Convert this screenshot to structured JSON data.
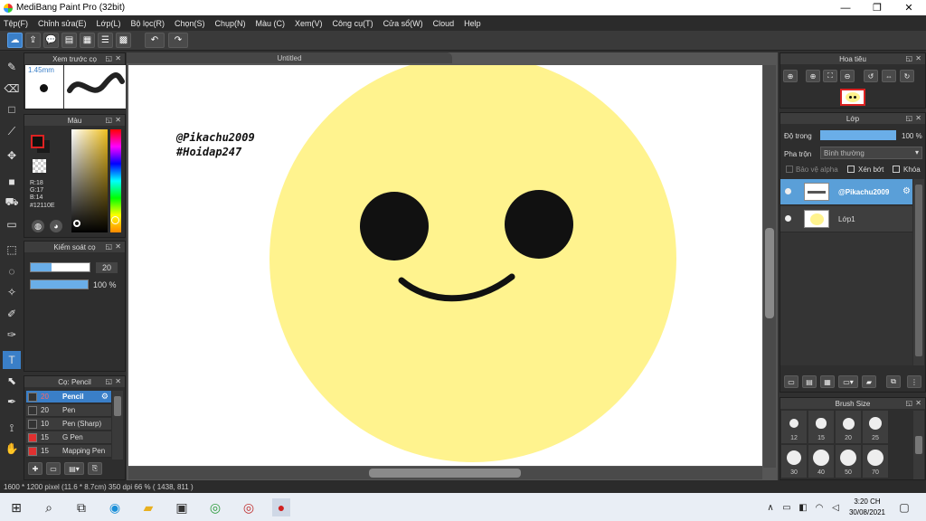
{
  "app": {
    "title": "MediBang Paint Pro (32bit)"
  },
  "window_controls": {
    "minimize": "—",
    "maximize": "❐",
    "close": "✕"
  },
  "menu": [
    "Tệp(F)",
    "Chỉnh sửa(E)",
    "Lớp(L)",
    "Bộ lọc(R)",
    "Chọn(S)",
    "Chụp(N)",
    "Màu (C)",
    "Xem(V)",
    "Công cụ(T)",
    "Cửa sổ(W)",
    "Cloud",
    "Help"
  ],
  "toolbar_icons": [
    "cloud-sync-icon",
    "upload-icon",
    "comment-icon",
    "message-icon",
    "page-icon",
    "list-icon",
    "grid-icon",
    "undo-icon",
    "redo-icon"
  ],
  "brush_preview": {
    "title": "Xem trước cọ",
    "size_label": "1.45mm"
  },
  "color_panel": {
    "title": "Màu",
    "r": "R:18",
    "g": "G:17",
    "b": "B:14",
    "hex": "#12110E",
    "fg_color": "#12110E",
    "bg_color": "#1a1a1a"
  },
  "brush_control": {
    "title": "Kiểm soát cọ",
    "size_value": "20",
    "opacity_value": "100 %",
    "size_fraction": 0.36,
    "opacity_fraction": 1.0
  },
  "brush_list": {
    "title": "Cọ: Pencil",
    "items": [
      {
        "size": "20",
        "name": "Pencil",
        "selected": true,
        "color": "#333333"
      },
      {
        "size": "20",
        "name": "Pen",
        "selected": false,
        "color": "#333333"
      },
      {
        "size": "10",
        "name": "Pen (Sharp)",
        "selected": false,
        "color": "#333333"
      },
      {
        "size": "15",
        "name": "G Pen",
        "selected": false,
        "color": "#e03030"
      },
      {
        "size": "15",
        "name": "Mapping Pen",
        "selected": false,
        "color": "#e03030"
      }
    ]
  },
  "document": {
    "tab_title": "Untitled",
    "watermark_line1": "@Pikachu2009",
    "watermark_line2": "#Hoidap247",
    "face_color": "#fff38e"
  },
  "navigator": {
    "title": "Hoa tiêu"
  },
  "layer_panel": {
    "title": "Lớp",
    "opacity_label": "Độ trong",
    "opacity_value": "100 %",
    "blend_label": "Pha trộn",
    "blend_value": "Bình thường",
    "protect_alpha": "Bảo vệ alpha",
    "clipping": "Xén bớt",
    "lock": "Khóa",
    "layers": [
      {
        "name": "@Pikachu2009",
        "selected": true
      },
      {
        "name": "Lớp1",
        "selected": false
      }
    ]
  },
  "brush_size_panel": {
    "title": "Brush Size",
    "sizes": [
      "12",
      "15",
      "20",
      "25",
      "30",
      "40",
      "50",
      "70"
    ]
  },
  "status": {
    "text": "1600 * 1200 pixel   (11.6 * 8.7cm)   350 dpi   66 %   ( 1438, 811 )"
  },
  "taskbar": {
    "time": "3:20 CH",
    "date": "30/08/2021"
  }
}
